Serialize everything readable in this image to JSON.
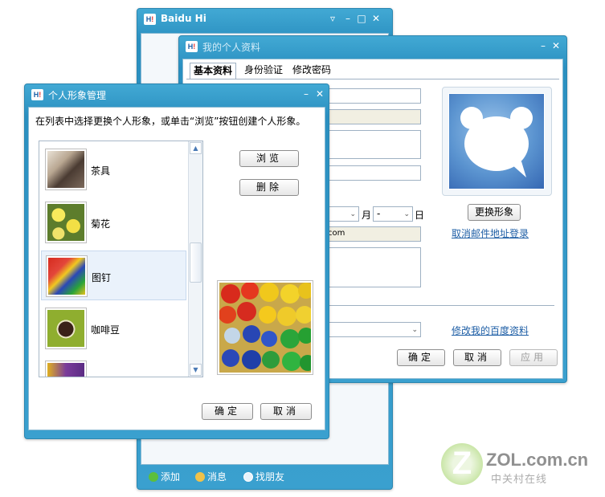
{
  "baidu_hi": {
    "title": "Baidu Hi",
    "bottom_bar": {
      "add": "添加",
      "message": "消息",
      "find_friends": "找朋友"
    }
  },
  "profile_window": {
    "title": "我的个人资料",
    "tabs": [
      "基本资料",
      "身份验证",
      "修改密码"
    ],
    "month_label": "月",
    "day_label": "日",
    "day_value": "-",
    "email_suffix": "com",
    "change_avatar_button": "更换形象",
    "cancel_email_login_link": "取消邮件地址登录",
    "edit_baidu_profile_link": "修改我的百度资料",
    "ok_button": "确定",
    "cancel_button": "取消",
    "apply_button": "应用"
  },
  "avatar_window": {
    "title": "个人形象管理",
    "instruction": "在列表中选择更换个人形象，或单击“浏览”按钮创建个人形象。",
    "browse_button": "浏览",
    "delete_button": "删除",
    "ok_button": "确定",
    "cancel_button": "取消",
    "items": [
      {
        "label": "茶具"
      },
      {
        "label": "菊花"
      },
      {
        "label": "图钉",
        "selected": true
      },
      {
        "label": "咖啡豆"
      }
    ]
  },
  "watermark": {
    "text": "ZOL.com.cn",
    "sub": "中关村在线"
  },
  "colors": {
    "title_bar": "#2a8fc0",
    "link": "#1f5fa6",
    "selected_row": "#eaf2fb"
  }
}
